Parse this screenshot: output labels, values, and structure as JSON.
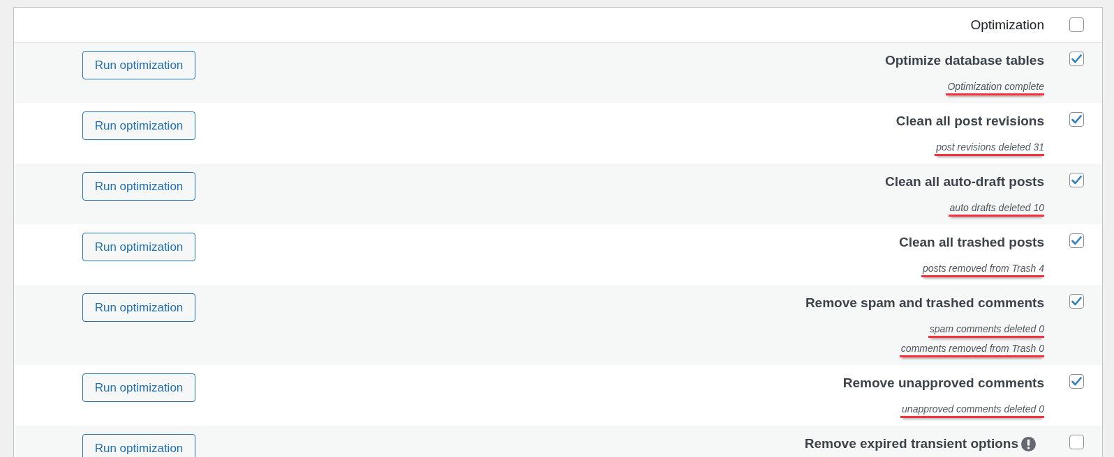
{
  "header": {
    "label": "Optimization",
    "checked": false
  },
  "rows": [
    {
      "button": "Run optimization",
      "title": "Optimize database tables",
      "checked": true,
      "info": false,
      "messages": [
        {
          "text": "Optimization complete",
          "highlighted": true
        }
      ]
    },
    {
      "button": "Run optimization",
      "title": "Clean all post revisions",
      "checked": true,
      "info": false,
      "messages": [
        {
          "text": "post revisions deleted 31",
          "highlighted": true
        }
      ]
    },
    {
      "button": "Run optimization",
      "title": "Clean all auto-draft posts",
      "checked": true,
      "info": false,
      "messages": [
        {
          "text": "auto drafts deleted 10",
          "highlighted": true
        }
      ]
    },
    {
      "button": "Run optimization",
      "title": "Clean all trashed posts",
      "checked": true,
      "info": false,
      "messages": [
        {
          "text": "posts removed from Trash 4",
          "highlighted": true
        }
      ]
    },
    {
      "button": "Run optimization",
      "title": "Remove spam and trashed comments",
      "checked": true,
      "info": false,
      "messages": [
        {
          "text": "spam comments deleted 0",
          "highlighted": true
        },
        {
          "text": "comments removed from Trash 0",
          "highlighted": true
        }
      ]
    },
    {
      "button": "Run optimization",
      "title": "Remove unapproved comments",
      "checked": true,
      "info": false,
      "messages": [
        {
          "text": "unapproved comments deleted 0",
          "highlighted": true
        }
      ]
    },
    {
      "button": "Run optimization",
      "title": "Remove expired transient options",
      "checked": false,
      "info": true
    }
  ]
}
